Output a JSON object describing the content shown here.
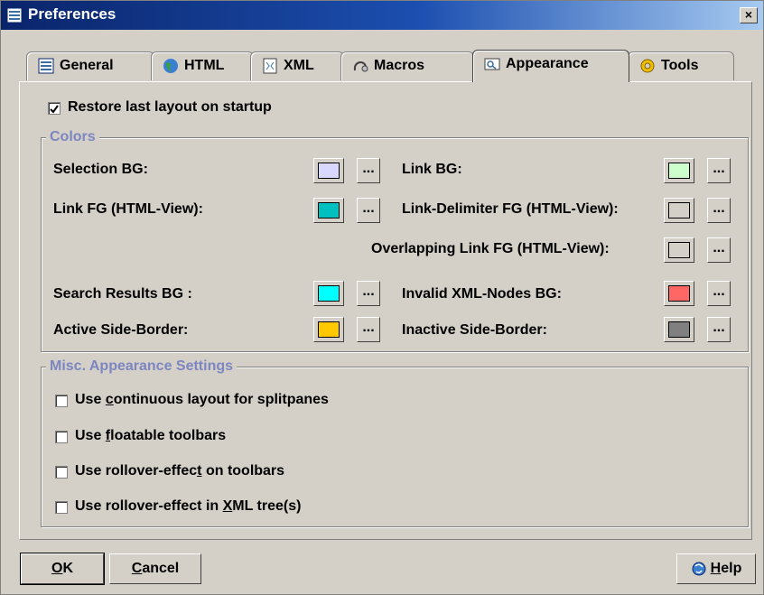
{
  "window": {
    "title": "Preferences",
    "close": "×"
  },
  "tabs": [
    {
      "label": "General",
      "icon": "general-icon"
    },
    {
      "label": "HTML",
      "icon": "globe-icon"
    },
    {
      "label": "XML",
      "icon": "xml-icon"
    },
    {
      "label": "Macros",
      "icon": "macros-icon"
    },
    {
      "label": "Appearance",
      "icon": "appearance-icon",
      "active": true
    },
    {
      "label": "Tools",
      "icon": "tools-icon"
    }
  ],
  "restore_layout": {
    "label": "Restore last layout on startup",
    "checked": true
  },
  "colors_group": {
    "title": "Colors",
    "selection_bg": {
      "label": "Selection BG:",
      "color": "#d8d8ff"
    },
    "link_bg": {
      "label": "Link BG:",
      "color": "#ccffcc"
    },
    "link_fg": {
      "label": "Link FG (HTML-View):",
      "color": "#00c0c0"
    },
    "link_delim_fg": {
      "label": "Link-Delimiter FG (HTML-View):",
      "color": "#d4d0c8"
    },
    "overlap_link_fg": {
      "label": "Overlapping Link FG (HTML-View):",
      "color": "#d4d0c8"
    },
    "search_bg": {
      "label": "Search Results BG :",
      "color": "#00ffff"
    },
    "invalid_xml_bg": {
      "label": "Invalid XML-Nodes BG:",
      "color": "#ff6666"
    },
    "active_border": {
      "label": "Active Side-Border:",
      "color": "#ffc800"
    },
    "inactive_border": {
      "label": "Inactive Side-Border:",
      "color": "#808080"
    },
    "ellipsis": "..."
  },
  "misc_group": {
    "title": "Misc. Appearance Settings",
    "options": [
      {
        "pre": "Use ",
        "u": "c",
        "post": "ontinuous layout for splitpanes",
        "checked": false
      },
      {
        "pre": "Use ",
        "u": "f",
        "post": "loatable toolbars",
        "checked": false
      },
      {
        "pre": "Use rollover-effec",
        "u": "t",
        "post": " on toolbars",
        "checked": false
      },
      {
        "pre": "Use rollover-effect in ",
        "u": "X",
        "post": "ML tree(s)",
        "checked": false
      }
    ]
  },
  "buttons": {
    "ok": {
      "u": "O",
      "rest": "K"
    },
    "cancel": {
      "u": "C",
      "rest": "ancel"
    },
    "help": {
      "u": "H",
      "rest": "elp",
      "icon": "help-icon"
    }
  }
}
